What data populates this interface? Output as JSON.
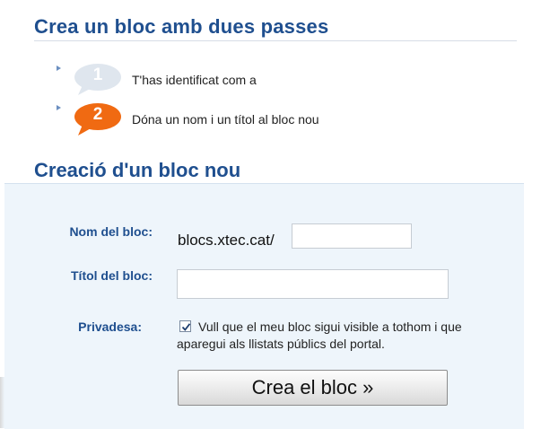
{
  "heading_main": "Crea un bloc amb dues passes",
  "steps": [
    {
      "number": "1",
      "text": "T'has identificat com a",
      "state": "done",
      "color": "#dfe6ee"
    },
    {
      "number": "2",
      "text": "Dóna un nom i un títol al bloc nou",
      "state": "active",
      "color": "#f06a12"
    }
  ],
  "heading_form": "Creació d'un bloc nou",
  "form": {
    "name_label": "Nom del bloc:",
    "name_prefix": "blocs.xtec.cat/",
    "name_value": "",
    "title_label": "Títol del bloc:",
    "title_value": "",
    "privacy_label": "Privadesa:",
    "privacy_checked": true,
    "privacy_text": "Vull que el meu bloc sigui visible a tothom i que aparegui als llistats públics del portal.",
    "submit_label": "Crea el bloc »"
  },
  "colors": {
    "heading": "#1f4f8f",
    "panel_bg": "#eef5fb",
    "step_active": "#f06a12",
    "step_done": "#dfe6ee"
  }
}
